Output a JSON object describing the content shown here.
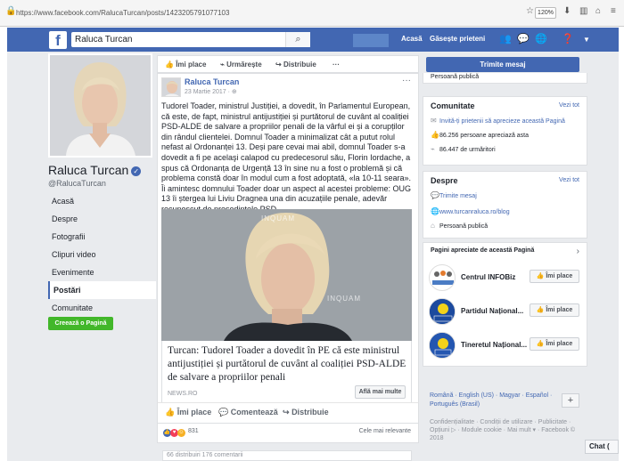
{
  "browser": {
    "url": "https://www.facebook.com/RalucaTurcan/posts/1423205791077103",
    "zoom": "120%"
  },
  "topbar": {
    "search_value": "Raluca Turcan",
    "home": "Acasă",
    "find_friends": "Găsește prieteni"
  },
  "page": {
    "name": "Raluca Turcan",
    "handle": "@RalucaTurcan",
    "nav": [
      "Acasă",
      "Despre",
      "Fotografii",
      "Clipuri video",
      "Evenimente",
      "Postări",
      "Comunitate"
    ],
    "nav_active": "Postări",
    "create_page": "Creează o Pagină"
  },
  "actions": {
    "like": "Îmi place",
    "follow": "Urmărește",
    "share": "Distribuie",
    "more": "···"
  },
  "post": {
    "author": "Raluca Turcan",
    "date": "23 Martie 2017 · ⊕",
    "text": "Tudorel Toader, ministrul Justiției, a dovedit, în Parlamentul European, că este, de fapt, ministrul antijustiției și purtătorul de cuvânt al coaliției PSD-ALDE de salvare a propriilor penali de la vârful ei și a corupților din rândul clientelei. Domnul Toader a minimalizat cât a putut rolul nefast al Ordonanței 13. Deși pare cevai mai abil, domnul Toader s-a dovedit a fi pe acelaşi calapod cu predecesorul său, Florin Iordache, a spus că Ordonanța de Urgență 13 în sine nu a fost o problemă și că problema constă doar în modul cum a fost adoptată, «la 10-11 seara». Îi amintesc domnului Toader doar un aspect al acestei probleme: OUG 13 îi ștergea lui Liviu Dragnea una din acuzațiile penale, adevăr recunoscut de președintele PSD.",
    "image_watermark": "INQUAM",
    "link_title": "Turcan: Tudorel Toader a dovedit în PE că este ministrul antijustiției și purtătorul de cuvânt al coaliției PSD-ALDE de salvare a propriilor penali",
    "link_source": "NEWS.RO",
    "link_more": "Află mai multe",
    "btn_like": "Îmi place",
    "btn_comment": "Comentează",
    "btn_share": "Distribuie",
    "reactions_count": "831",
    "sort": "Cele mai relevante",
    "partial_bottom": "66 distribuiri                                              176 comentarii"
  },
  "right": {
    "send_message": "Trimite mesaj",
    "category": "Persoană publică",
    "community_title": "Comunitate",
    "see_all": "Vezi tot",
    "invite": "Invită-ți prietenii să aprecieze această Pagină",
    "likes": "86.256 persoane apreciază asta",
    "followers": "86.447 de urmăritori",
    "about_title": "Despre",
    "about_send": "Trimite mesaj",
    "about_site": "www.turcanraluca.ro/blog",
    "about_category": "Persoană publică",
    "liked_title": "Pagini apreciate de această Pagină",
    "liked": [
      {
        "name": "Centrul INFOBiz",
        "btn": "Îmi place"
      },
      {
        "name": "Partidul Național...",
        "btn": "Îmi place"
      },
      {
        "name": "Tineretul Național...",
        "btn": "Îmi place"
      }
    ],
    "languages": "Română · English (US) · Magyar · Español · Português (Brasil)",
    "footer": "Confidențialitate · Condiții de utilizare · Publicitate · Opțiuni ▷ · Module cookie · Mai mult ▾ · Facebook © 2018",
    "chat": "Chat ("
  },
  "colors": {
    "brand": "#4267b2",
    "green": "#42b72a",
    "bg": "#e9ebee"
  }
}
